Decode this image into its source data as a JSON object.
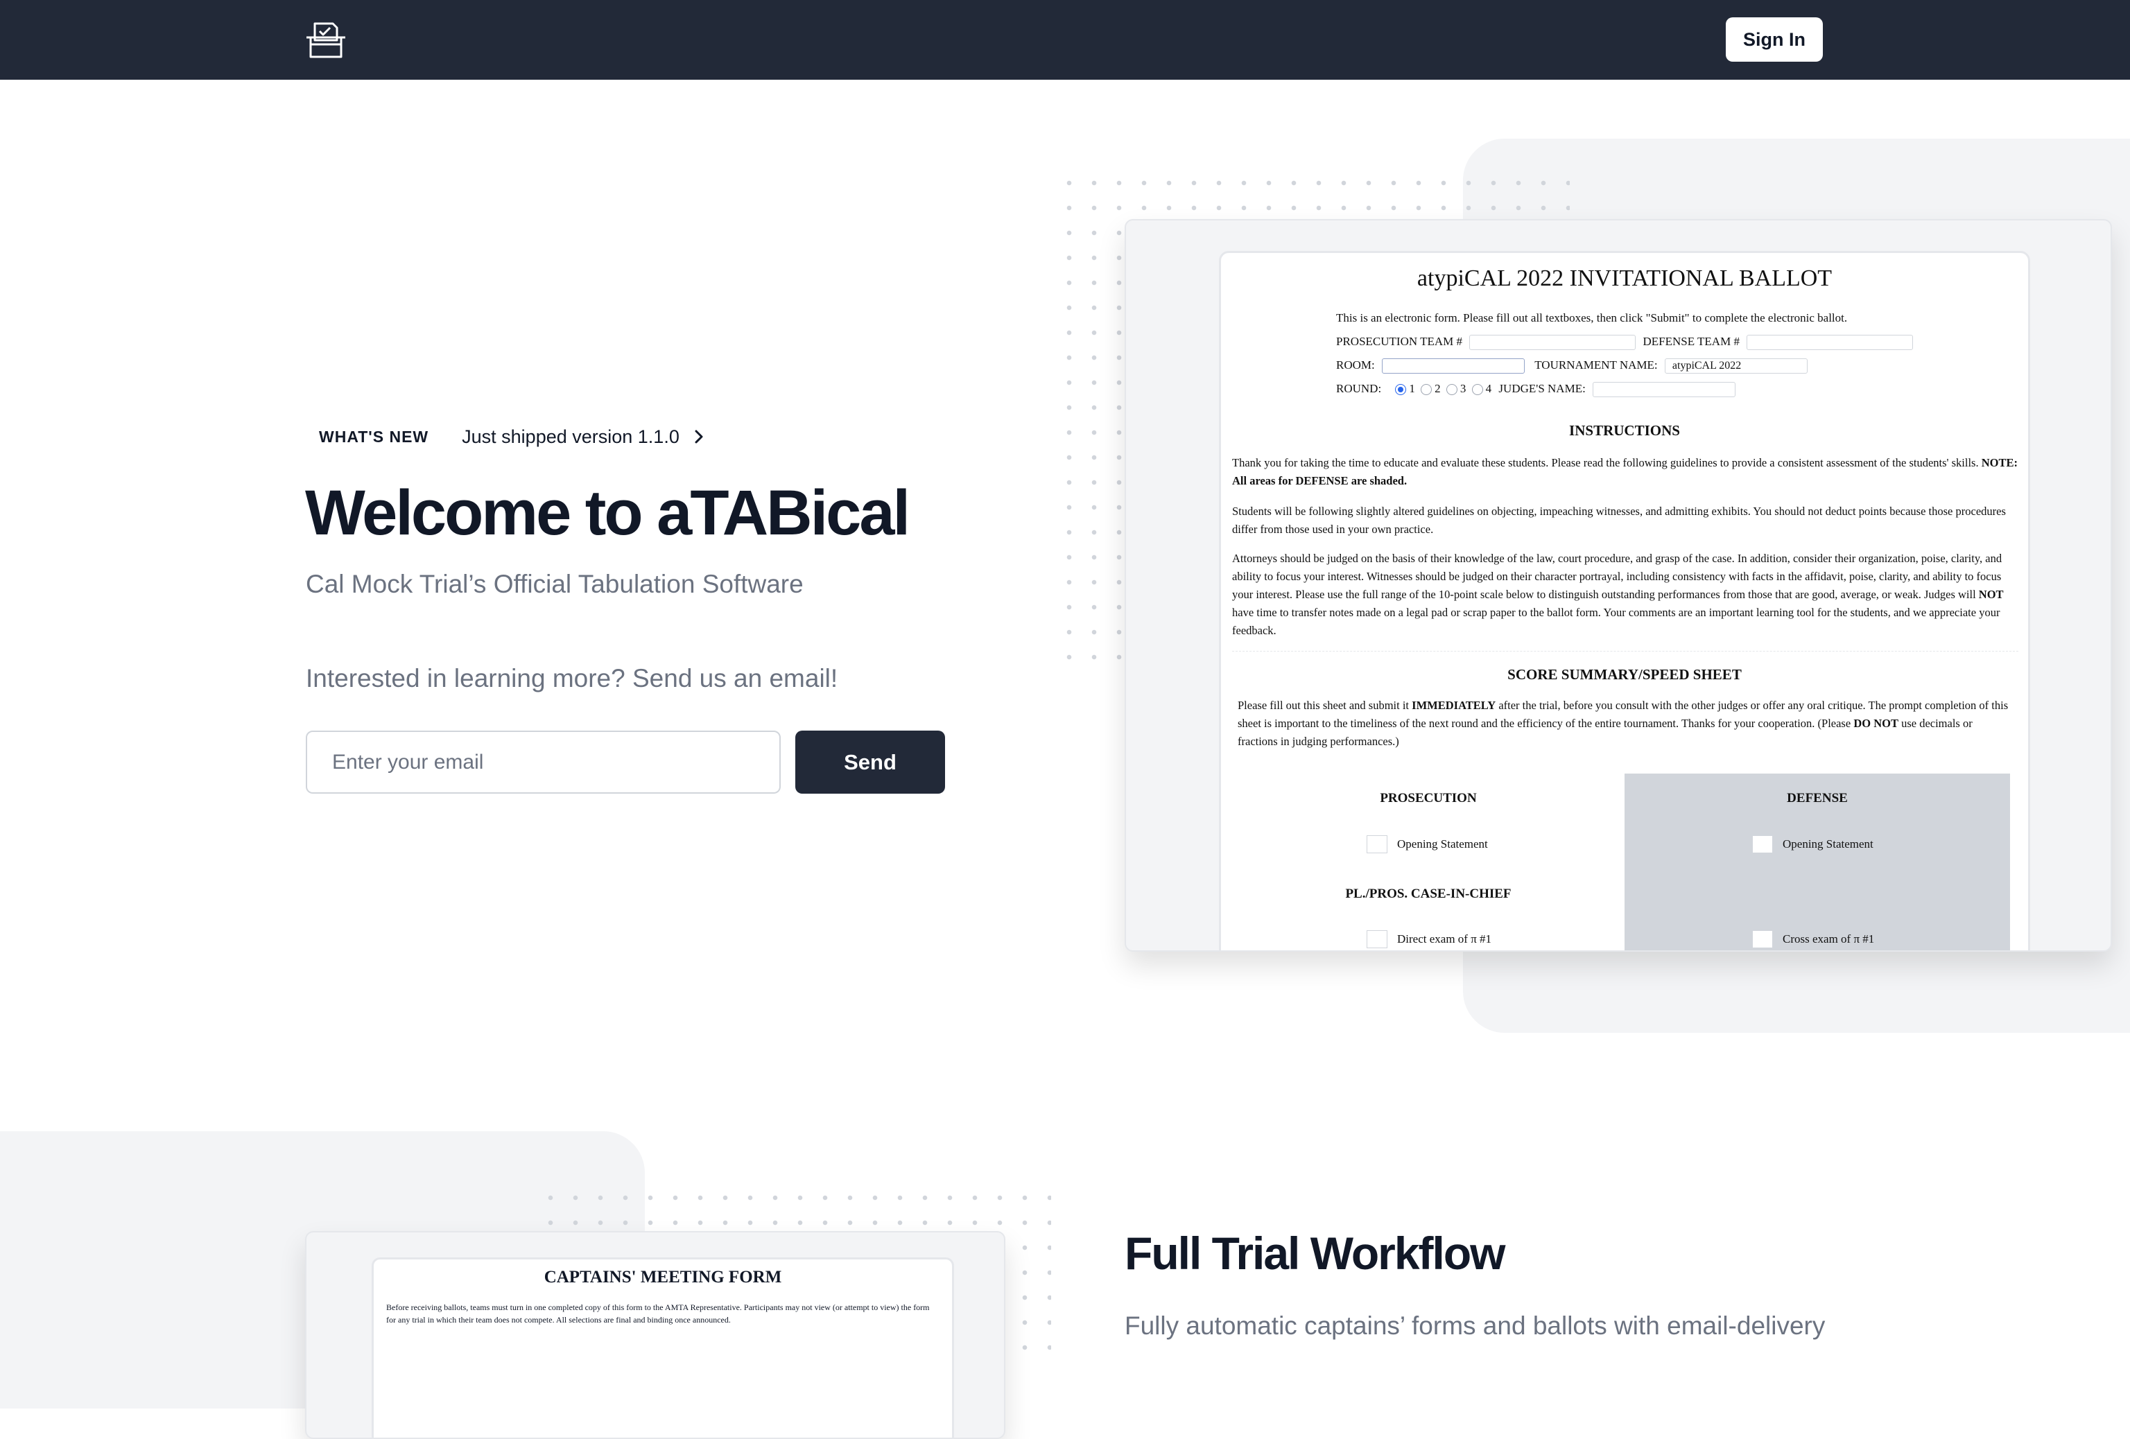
{
  "nav": {
    "signin_label": "Sign In",
    "logo_icon": "ballot-box-icon"
  },
  "hero": {
    "badge": "WHAT'S NEW",
    "announcement": "Just shipped version 1.1.0",
    "title": "Welcome to aTABical",
    "subtitle": "Cal Mock Trial’s Official Tabulation Software",
    "interest": "Interested in learning more? Send us an email!",
    "email_placeholder": "Enter your email",
    "send_label": "Send"
  },
  "ballot": {
    "title": "atypiCAL 2022 INVITATIONAL BALLOT",
    "intro": "This is an electronic form. Please fill out all textboxes, then click \"Submit\" to complete the electronic ballot.",
    "prosecution_team_label": "PROSECUTION TEAM #",
    "defense_team_label": "DEFENSE TEAM #",
    "room_label": "ROOM:",
    "tournament_name_label": "TOURNAMENT NAME:",
    "tournament_name_value": "atypiCAL 2022",
    "round_label": "ROUND:",
    "round_options": [
      "1",
      "2",
      "3",
      "4"
    ],
    "judge_name_label": "JUDGE'S NAME:",
    "instructions_heading": "INSTRUCTIONS",
    "para1_a": "Thank you for taking the time to educate and evaluate these students. Please read the following guidelines to provide a consistent assessment of the students' skills. ",
    "para1_b": "NOTE: All areas for DEFENSE are shaded.",
    "para2": "Students will be following slightly altered guidelines on objecting, impeaching witnesses, and admitting exhibits. You should not deduct points because those procedures differ from those used in your own practice.",
    "para3_a": "Attorneys should be judged on the basis of their knowledge of the law, court procedure, and grasp of the case. In addition, consider their organization, poise, clarity, and ability to focus your interest. Witnesses should be judged on their character portrayal, including consistency with facts in the affidavit, poise, clarity, and ability to focus your interest. Please use the full range of the 10-point scale below to distinguish outstanding performances from those that are good, average, or weak. Judges will ",
    "para3_b": "NOT",
    "para3_c": " have time to transfer notes made on a legal pad or scrap paper to the ballot form. Your comments are an important learning tool for the students, and we appreciate your feedback.",
    "summary_heading": "SCORE SUMMARY/SPEED SHEET",
    "summary_a": "Please fill out this sheet and submit it ",
    "summary_b": "IMMEDIATELY",
    "summary_c": " after the trial, before you consult with the other judges or offer any oral critique. The prompt completion of this sheet is important to the timeliness of the next round and the efficiency of the entire tournament. Thanks for your cooperation. (Please ",
    "summary_d": "DO NOT",
    "summary_e": " use decimals or fractions in judging performances.)",
    "prosecution_heading": "PROSECUTION",
    "defense_heading": "DEFENSE",
    "p_opening": "Opening Statement",
    "d_opening": "Opening Statement",
    "case_in_chief_heading": "PL./PROS. CASE-IN-CHIEF",
    "p_direct": "Direct exam of π #1",
    "d_cross": "Cross exam of π #1"
  },
  "captains_form": {
    "title": "CAPTAINS' MEETING FORM",
    "text": "Before receiving ballots, teams must turn in one completed copy of this form to the AMTA Representative. Participants may not view (or attempt to view) the form for any trial in which their team does not compete. All selections are final and binding once announced."
  },
  "workflow": {
    "title": "Full Trial Workflow",
    "subtitle": "Fully automatic captains’ forms and ballots with email-delivery"
  }
}
